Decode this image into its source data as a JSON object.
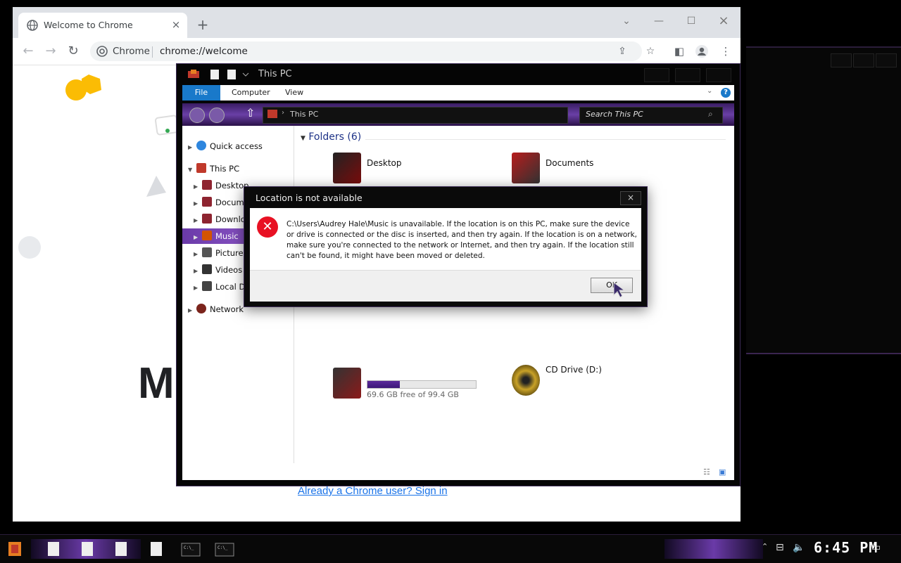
{
  "chrome": {
    "tab_title": "Welcome to Chrome",
    "tab_close": "×",
    "new_tab": "+",
    "site_label": "Chrome",
    "url": "chrome://welcome",
    "page_heading_partial": "M",
    "signin_link": "Already a Chrome user? Sign in"
  },
  "explorer": {
    "title": "This PC",
    "ribbon_tabs": [
      "File",
      "Computer",
      "View"
    ],
    "address": "This PC",
    "search_placeholder": "Search This PC",
    "nav": {
      "quick_access": "Quick access",
      "this_pc": "This PC",
      "children": [
        "Desktop",
        "Docum",
        "Downlo",
        "Music",
        "Picture",
        "Videos",
        "Local D"
      ],
      "network": "Network"
    },
    "folders_header": "Folders (6)",
    "folders": [
      "Desktop",
      "Documents"
    ],
    "drives": [
      {
        "name": "",
        "free": "69.6 GB free of 99.4 GB",
        "used_fraction": 0.3
      },
      {
        "name": "CD Drive (D:)"
      }
    ]
  },
  "dialog": {
    "title": "Location is not available",
    "close": "×",
    "message": "C:\\Users\\Audrey Hale\\Music is unavailable. If the location is on this PC, make sure the device or drive is connected or the disc is inserted, and then try again. If the location is on a network, make sure you're connected to the network or Internet, and then try again. If the location still can't be found, it might have been moved or deleted.",
    "ok": "OK"
  },
  "taskbar": {
    "time": "6:45 PM"
  },
  "colors": {
    "accent_purple": "#6a3aa8",
    "error_red": "#e81123",
    "chrome_blue": "#1a73e8"
  }
}
